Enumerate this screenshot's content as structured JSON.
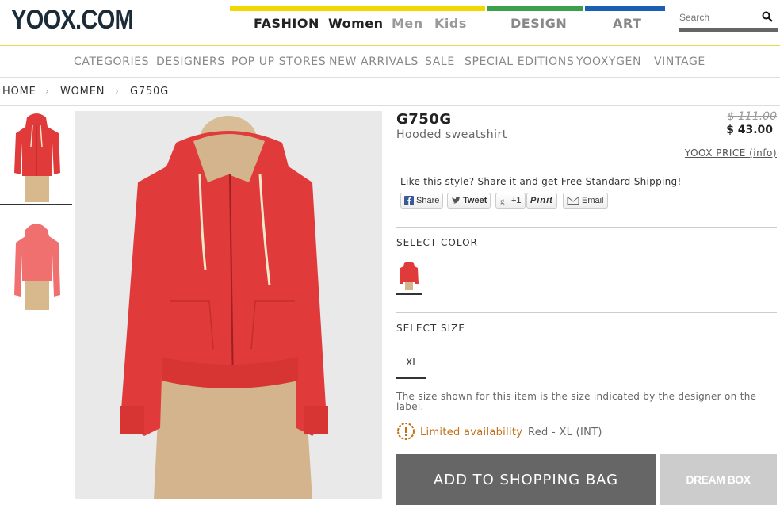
{
  "header": {
    "logo": "YOOX.COM",
    "nav": {
      "fashion": "FASHION",
      "women": "Women",
      "men": "Men",
      "kids": "Kids",
      "design": "DESIGN",
      "art": "ART"
    },
    "search": {
      "placeholder": "Search",
      "icon": "search-icon"
    },
    "colors": {
      "fashion_bar": "#f0d800",
      "design_bar": "#3aa04a",
      "art_bar": "#1a5fb4"
    }
  },
  "category_nav": [
    "CATEGORIES",
    "DESIGNERS",
    "POP UP STORES",
    "NEW ARRIVALS",
    "SALE",
    "SPECIAL EDITIONS",
    "YOOXYGEN",
    "VINTAGE"
  ],
  "breadcrumb": {
    "home": "HOME",
    "women": "WOMEN",
    "current": "G750G",
    "separator": "›"
  },
  "product": {
    "brand": "G750G",
    "name": "Hooded sweatshirt",
    "old_price": "$ 111.00",
    "price": "$ 43.00",
    "price_info": "YOOX PRICE (info)",
    "share_text": "Like this style? Share it and get Free Standard Shipping!",
    "share_buttons": {
      "facebook": "Share",
      "twitter": "Tweet",
      "google": "+1",
      "pinterest": "Pinit",
      "email": "Email"
    },
    "select_color_label": "SELECT COLOR",
    "select_size_label": "SELECT SIZE",
    "size": "XL",
    "size_note": "The size shown for this item is the size indicated by the designer on the label.",
    "availability": "Limited availability",
    "availability_detail": "Red - XL (INT)",
    "add_to_bag": "ADD TO SHOPPING BAG",
    "dream_box": "DREAM BOX",
    "colors": {
      "garment": "#e03a3a",
      "availability": "#c0701a"
    }
  }
}
